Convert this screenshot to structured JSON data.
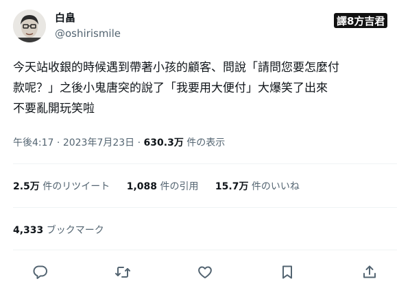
{
  "header": {
    "display_name": "白畠",
    "handle": "@oshirismile",
    "watermark": "譯8方吉君"
  },
  "tweet": {
    "text_line1": "今天站收銀的時候遇到帶著小孩的顧客、問說「請問您要怎麼付",
    "text_line2": "款呢？」之後小鬼唐突的說了「我要用大便付」大爆笑了出來",
    "text_line3": "不要亂開玩笑啦"
  },
  "meta": {
    "time": "午後4:17",
    "separator": " · ",
    "date": "2023年7月23日",
    "views_count": "630.3万",
    "views_label": "件の表示"
  },
  "stats": {
    "retweets_count": "2.5万",
    "retweets_label": "件のリツイート",
    "quotes_count": "1,088",
    "quotes_label": "件の引用",
    "likes_count": "15.7万",
    "likes_label": "件のいいね",
    "bookmarks_count": "4,333",
    "bookmarks_label": "ブックマーク"
  },
  "actions": {
    "icons": [
      "reply-icon",
      "retweet-icon",
      "like-icon",
      "bookmark-icon",
      "share-icon"
    ]
  }
}
